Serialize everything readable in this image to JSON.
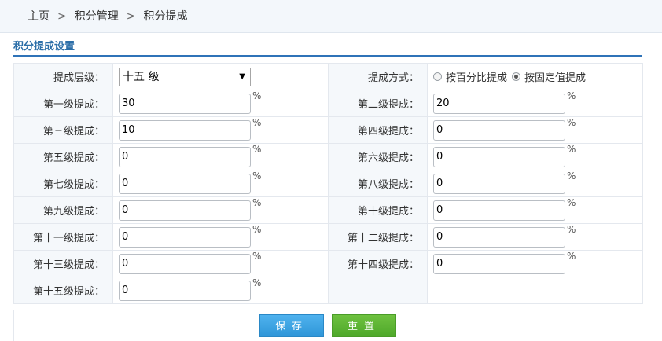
{
  "breadcrumb": {
    "home": "主页",
    "sep": ">",
    "level1": "积分管理",
    "level2": "积分提成"
  },
  "section_title": "积分提成设置",
  "level_field": {
    "label": "提成层级：",
    "value": "十五 级"
  },
  "method_field": {
    "label": "提成方式：",
    "options": [
      {
        "label": "按百分比提成",
        "checked": false
      },
      {
        "label": "按固定值提成",
        "checked": true
      }
    ]
  },
  "unit": "%",
  "levels": [
    {
      "label": "第一级提成：",
      "value": "30"
    },
    {
      "label": "第二级提成：",
      "value": "20"
    },
    {
      "label": "第三级提成：",
      "value": "10"
    },
    {
      "label": "第四级提成：",
      "value": "0"
    },
    {
      "label": "第五级提成：",
      "value": "0"
    },
    {
      "label": "第六级提成：",
      "value": "0"
    },
    {
      "label": "第七级提成：",
      "value": "0"
    },
    {
      "label": "第八级提成：",
      "value": "0"
    },
    {
      "label": "第九级提成：",
      "value": "0"
    },
    {
      "label": "第十级提成：",
      "value": "0"
    },
    {
      "label": "第十一级提成：",
      "value": "0"
    },
    {
      "label": "第十二级提成：",
      "value": "0"
    },
    {
      "label": "第十三级提成：",
      "value": "0"
    },
    {
      "label": "第十四级提成：",
      "value": "0"
    },
    {
      "label": "第十五级提成：",
      "value": "0"
    }
  ],
  "buttons": {
    "save": "保存",
    "reset": "重置"
  },
  "colors": {
    "accent": "#2f73b8",
    "save_button": "#3aa2e3",
    "reset_button": "#5cb535"
  }
}
